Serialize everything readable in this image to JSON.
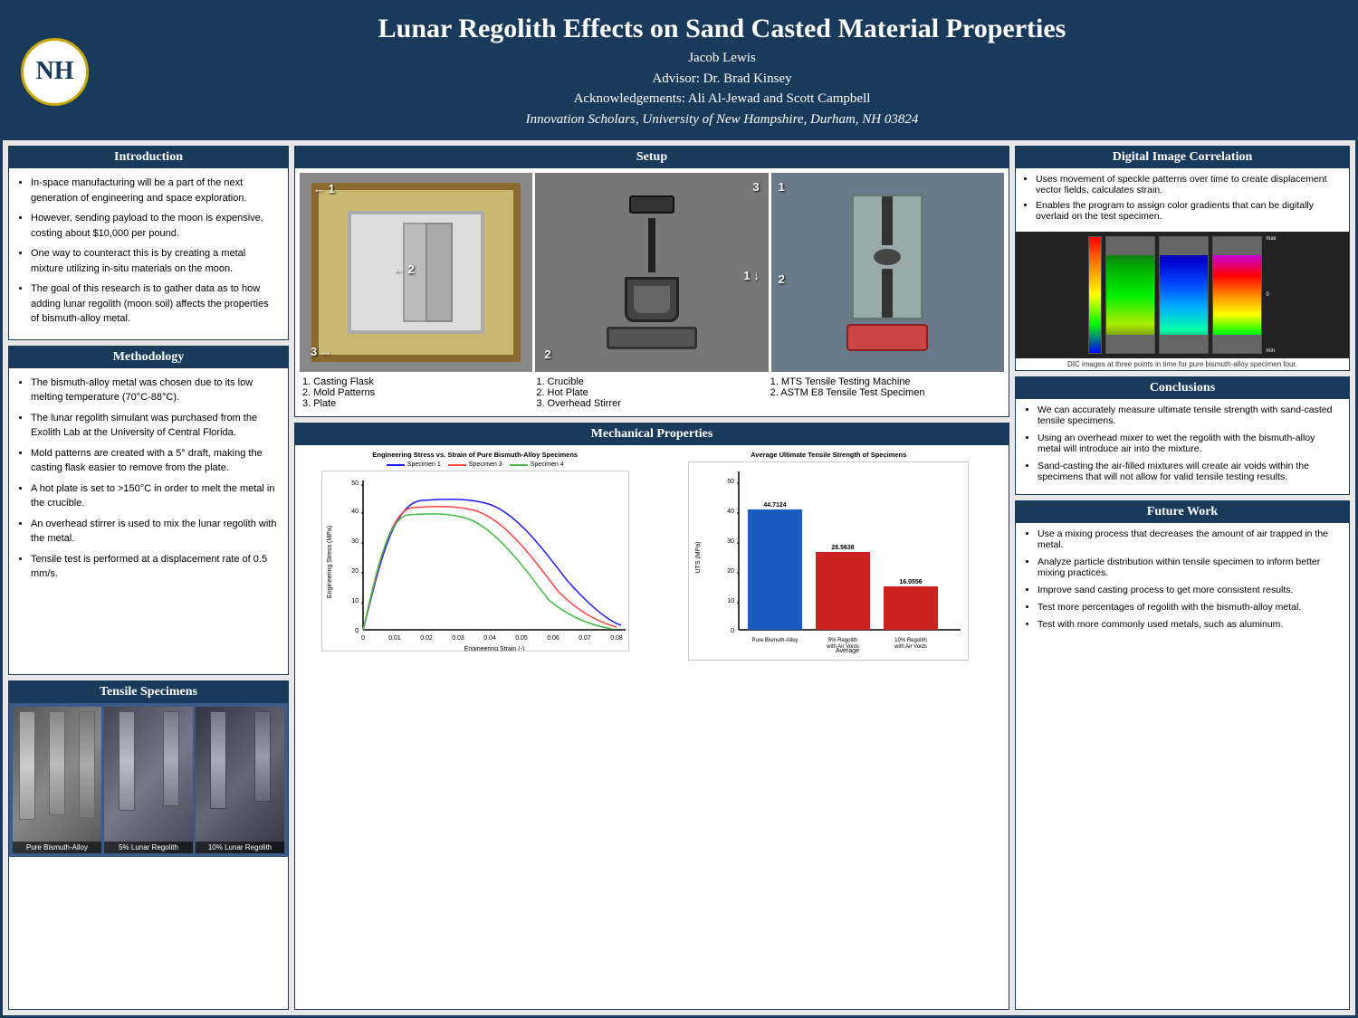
{
  "header": {
    "title": "Lunar Regolith Effects on Sand Casted Material Properties",
    "author": "Jacob Lewis",
    "advisor": "Advisor: Dr. Brad Kinsey",
    "acknowledgements": "Acknowledgements: Ali Al-Jewad and Scott Campbell",
    "institution": "Innovation Scholars, University of New Hampshire, Durham, NH 03824",
    "logo_text": "NH"
  },
  "introduction": {
    "heading": "Introduction",
    "bullets": [
      "In-space manufacturing will be a part of the next generation of engineering and space exploration.",
      "However, sending payload to the moon is expensive, costing about $10,000 per pound.",
      "One way to counteract this is by creating a metal mixture utilizing in-situ materials on the moon.",
      "The goal of this research is to gather data as to how adding lunar regolith (moon soil) affects the properties of bismuth-alloy metal."
    ]
  },
  "methodology": {
    "heading": "Methodology",
    "bullets": [
      "The bismuth-alloy metal was chosen due to its low melting temperature (70°C-88°C).",
      "The lunar regolith simulant was purchased from the Exolith Lab at the University of Central Florida.",
      "Mold patterns are created with a 5° draft, making the casting flask easier to remove from the plate.",
      "A hot plate is set to >150°C in order to melt the metal in the crucible.",
      "An overhead stirrer is used to mix the lunar regolith with the metal.",
      "Tensile test is performed at a displacement rate of 0.5 mm/s."
    ]
  },
  "setup": {
    "heading": "Setup",
    "left_labels": [
      "1. Casting Flask",
      "2. Mold Patterns",
      "3. Plate"
    ],
    "mid_labels": [
      "1. Crucible",
      "2. Hot Plate",
      "3. Overhead Stirrer"
    ],
    "right_labels": [
      "1. MTS Tensile Testing Machine",
      "2. ASTM E8 Tensile Test Specimen"
    ]
  },
  "tensile_specimens": {
    "heading": "Tensile Specimens",
    "labels": [
      "Pure Bismuth-Alloy",
      "5% Lunar Regolith",
      "10% Lunar Regolith"
    ]
  },
  "mechanical_properties": {
    "heading": "Mechanical Properties",
    "stress_strain_title": "Engineering Stress vs. Strain of Pure Bismuth-Alloy Specimens",
    "bar_chart_title": "Average Ultimate Tensile Strength of Specimens",
    "legend": [
      "Specimen 1",
      "Specimen 3",
      "Specimen 4"
    ],
    "bar_labels": [
      "Pure Bismuth-Alloy",
      "5% Regolith with Air Voids",
      "10% Regolith with Air Voids"
    ],
    "bar_values": [
      44.7124,
      28.5638,
      16.0556
    ],
    "x_axis_label": "Engineering Strain (-)",
    "y_axis_label": "Engineering Stress (MPa)",
    "bar_y_label": "UTS (MPa)",
    "bar_x_label": "Average"
  },
  "dic": {
    "heading": "Digital Image Correlation",
    "bullets": [
      "Uses movement of speckle patterns over time to create displacement vector fields, calculates strain.",
      "Enables the program to assign color gradients that can be digitally overlaid on the test specimen."
    ],
    "caption": "DIC images at three points in time for pure bismuth-alloy specimen four."
  },
  "conclusions": {
    "heading": "Conclusions",
    "bullets": [
      "We can accurately measure ultimate tensile strength with sand-casted tensile specimens.",
      "Using an overhead mixer to wet the regolith with the bismuth-alloy metal will introduce air into the mixture.",
      "Sand-casting the air-filled mixtures will create air voids within the specimens that will not allow for valid tensile testing results."
    ]
  },
  "future_work": {
    "heading": "Future Work",
    "bullets": [
      "Use a mixing process that decreases the amount of air trapped in the metal.",
      "Analyze particle distribution within tensile specimen to inform better mixing practices.",
      "Improve sand casting process to get more consistent results.",
      "Test more percentages of regolith with the bismuth-alloy metal.",
      "Test with more commonly used metals, such as aluminum."
    ]
  }
}
